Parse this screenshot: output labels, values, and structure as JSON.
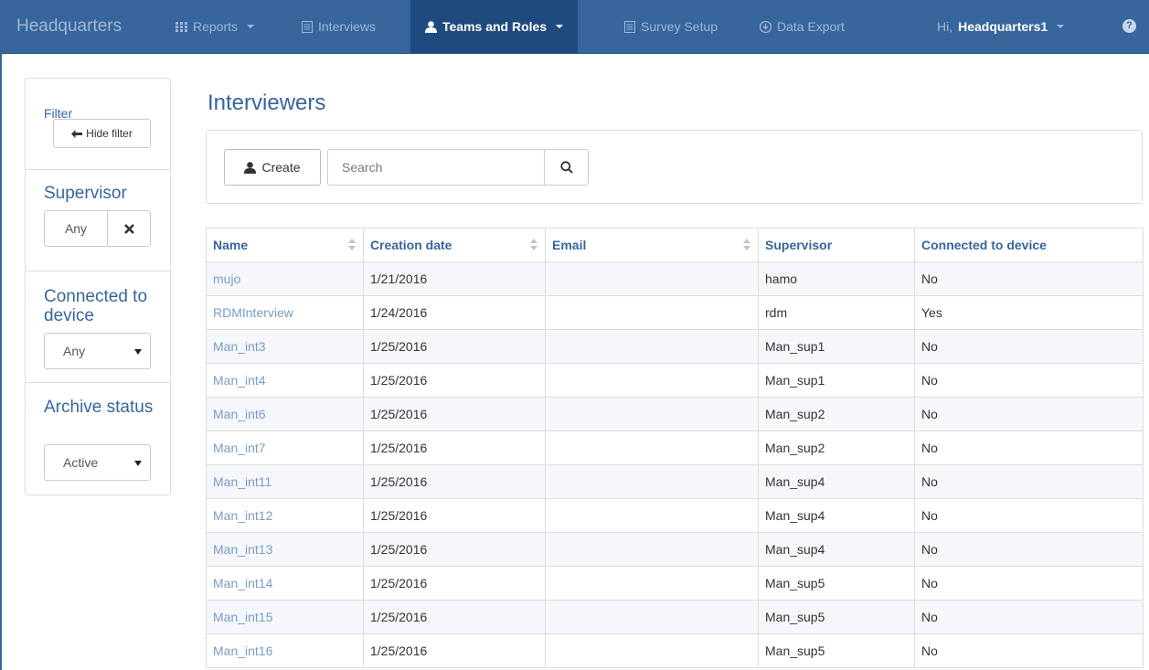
{
  "nav": {
    "brand": "Headquarters",
    "reports": "Reports",
    "interviews": "Interviews",
    "teams_and_roles": "Teams and Roles",
    "survey_setup": "Survey Setup",
    "data_export": "Data Export",
    "greeting": "Hi,",
    "user": "Headquarters1",
    "help": "?"
  },
  "filter": {
    "title": "Filter",
    "hide_filter": "Hide filter",
    "supervisor_label": "Supervisor",
    "supervisor_value": "Any",
    "connected_label": "Connected to device",
    "connected_value": "Any",
    "archive_label": "Archive status",
    "archive_value": "Active"
  },
  "main": {
    "title": "Interviewers",
    "create_label": "Create",
    "search_placeholder": "Search"
  },
  "table": {
    "columns": [
      "Name",
      "Creation date",
      "Email",
      "Supervisor",
      "Connected to device"
    ],
    "rows": [
      {
        "name": "mujo",
        "date": "1/21/2016",
        "email": "",
        "supervisor": "hamo",
        "connected": "No"
      },
      {
        "name": "RDMInterview",
        "date": "1/24/2016",
        "email": "",
        "supervisor": "rdm",
        "connected": "Yes"
      },
      {
        "name": "Man_int3",
        "date": "1/25/2016",
        "email": "",
        "supervisor": "Man_sup1",
        "connected": "No"
      },
      {
        "name": "Man_int4",
        "date": "1/25/2016",
        "email": "",
        "supervisor": "Man_sup1",
        "connected": "No"
      },
      {
        "name": "Man_int6",
        "date": "1/25/2016",
        "email": "",
        "supervisor": "Man_sup2",
        "connected": "No"
      },
      {
        "name": "Man_int7",
        "date": "1/25/2016",
        "email": "",
        "supervisor": "Man_sup2",
        "connected": "No"
      },
      {
        "name": "Man_int11",
        "date": "1/25/2016",
        "email": "",
        "supervisor": "Man_sup4",
        "connected": "No"
      },
      {
        "name": "Man_int12",
        "date": "1/25/2016",
        "email": "",
        "supervisor": "Man_sup4",
        "connected": "No"
      },
      {
        "name": "Man_int13",
        "date": "1/25/2016",
        "email": "",
        "supervisor": "Man_sup4",
        "connected": "No"
      },
      {
        "name": "Man_int14",
        "date": "1/25/2016",
        "email": "",
        "supervisor": "Man_sup5",
        "connected": "No"
      },
      {
        "name": "Man_int15",
        "date": "1/25/2016",
        "email": "",
        "supervisor": "Man_sup5",
        "connected": "No"
      },
      {
        "name": "Man_int16",
        "date": "1/25/2016",
        "email": "",
        "supervisor": "Man_sup5",
        "connected": "No"
      }
    ]
  },
  "colors": {
    "navbar": "#37669d",
    "navbar_active": "#1e4a7d",
    "accent": "#37669d",
    "link": "#7a9cc6"
  }
}
